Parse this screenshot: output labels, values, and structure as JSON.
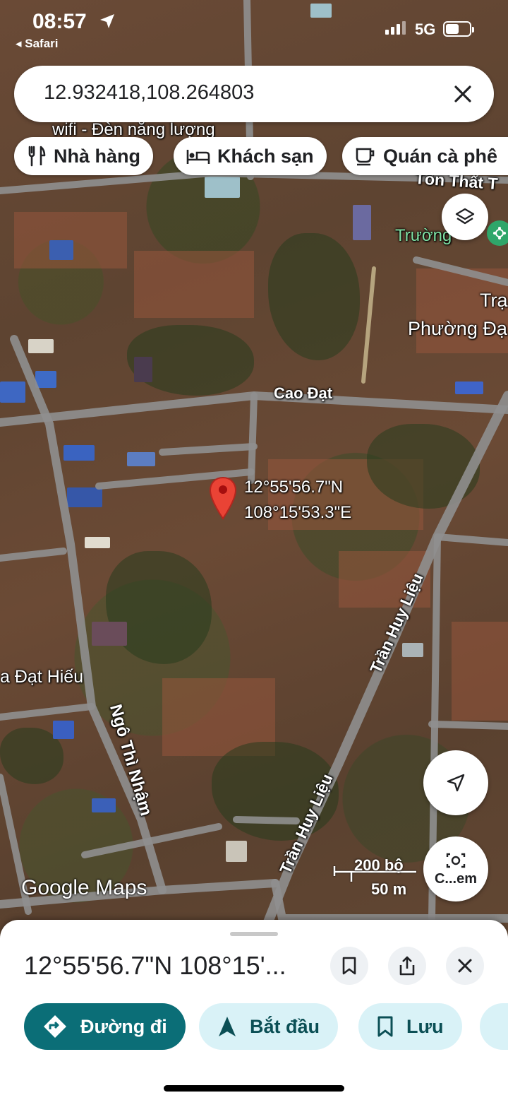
{
  "status_bar": {
    "time": "08:57",
    "back_app": "◂ Safari",
    "network": "5G"
  },
  "search": {
    "query": "12.932418,108.264803"
  },
  "chips": [
    {
      "label": "Nhà hàng",
      "icon": "restaurant-icon"
    },
    {
      "label": "Khách sạn",
      "icon": "hotel-icon"
    },
    {
      "label": "Quán cà phê",
      "icon": "coffee-icon"
    }
  ],
  "map": {
    "labels": {
      "poi_top": "wifi - Đèn năng lượng",
      "road_ton_that": "Tôn Thất T",
      "school": "Trường",
      "poi_tram": "Trạ",
      "poi_phuong": "Phường Đạ",
      "road_cao_dat": "Cao Đạt",
      "road_dat_hieu": "a Đạt Hiếu",
      "road_ngo_thi_nham": "Ngô Thì Nhậm",
      "road_tran_huy_lieu_1": "Trần Huy Liệu",
      "road_tran_huy_lieu_2": "Trần Huy Liệu"
    },
    "pin": {
      "lat_label": "12°55'56.7\"N",
      "lng_label": "108°15'53.3\"E"
    },
    "scale": {
      "imperial": "200 bộ",
      "metric": "50 m"
    },
    "logo": "Google Maps",
    "street_view_label": "C...em"
  },
  "sheet": {
    "title": "12°55'56.7\"N 108°15'...",
    "actions": [
      {
        "label": "Đường đi",
        "icon": "directions-icon"
      },
      {
        "label": "Bắt đầu",
        "icon": "navigation-arrow-icon"
      },
      {
        "label": "Lưu",
        "icon": "bookmark-icon"
      }
    ]
  },
  "colors": {
    "primary_teal": "#0b6e77",
    "chip_light": "#d9f2f7",
    "pin_red": "#ea4335"
  }
}
